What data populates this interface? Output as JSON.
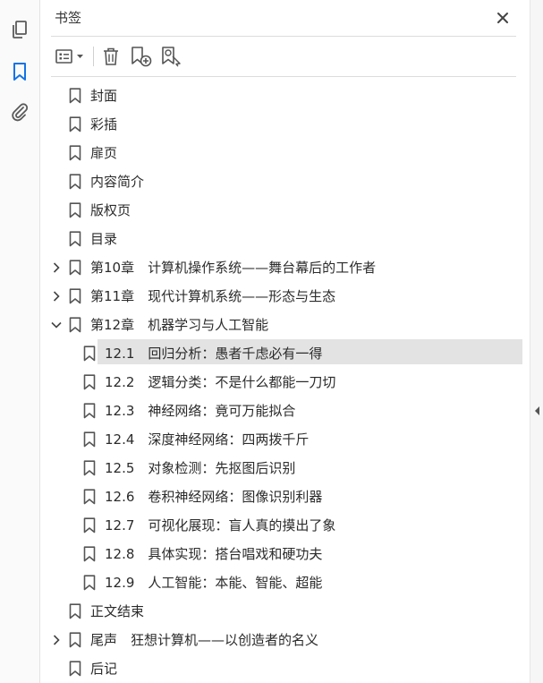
{
  "panel": {
    "title": "书签"
  },
  "toolbar": {
    "options": "options-menu-icon",
    "delete": "trash-icon",
    "new_bookmark": "new-bookmark-icon",
    "find_bookmark": "find-bookmark-icon"
  },
  "rail": {
    "pages": "pages-icon",
    "bookmarks": "bookmark-icon",
    "attachments": "paperclip-icon"
  },
  "bookmarks": [
    {
      "label": "封面",
      "level": 0,
      "expander": "none"
    },
    {
      "label": "彩插",
      "level": 0,
      "expander": "none"
    },
    {
      "label": "扉页",
      "level": 0,
      "expander": "none"
    },
    {
      "label": "内容简介",
      "level": 0,
      "expander": "none"
    },
    {
      "label": "版权页",
      "level": 0,
      "expander": "none"
    },
    {
      "label": "目录",
      "level": 0,
      "expander": "none"
    },
    {
      "label": "第10章　计算机操作系统——舞台幕后的工作者",
      "level": 0,
      "expander": "collapsed"
    },
    {
      "label": "第11章　现代计算机系统——形态与生态",
      "level": 0,
      "expander": "collapsed"
    },
    {
      "label": "第12章　机器学习与人工智能",
      "level": 0,
      "expander": "expanded"
    },
    {
      "label": "12.1　回归分析：愚者千虑必有一得",
      "level": 1,
      "expander": "none",
      "selected": true
    },
    {
      "label": "12.2　逻辑分类：不是什么都能一刀切",
      "level": 1,
      "expander": "none"
    },
    {
      "label": "12.3　神经网络：竟可万能拟合",
      "level": 1,
      "expander": "none"
    },
    {
      "label": "12.4　深度神经网络：四两拨千斤",
      "level": 1,
      "expander": "none"
    },
    {
      "label": "12.5　对象检测：先抠图后识别",
      "level": 1,
      "expander": "none"
    },
    {
      "label": "12.6　卷积神经网络：图像识别利器",
      "level": 1,
      "expander": "none"
    },
    {
      "label": "12.7　可视化展现：盲人真的摸出了象",
      "level": 1,
      "expander": "none"
    },
    {
      "label": "12.8　具体实现：搭台唱戏和硬功夫",
      "level": 1,
      "expander": "none"
    },
    {
      "label": "12.9　人工智能：本能、智能、超能",
      "level": 1,
      "expander": "none"
    },
    {
      "label": "正文结束",
      "level": 0,
      "expander": "none"
    },
    {
      "label": "尾声　狂想计算机——以创造者的名义",
      "level": 0,
      "expander": "collapsed"
    },
    {
      "label": "后记",
      "level": 0,
      "expander": "none"
    }
  ],
  "colors": {
    "accent": "#1473e6",
    "icon": "#555555",
    "selected_bg": "#e3e3e3"
  }
}
